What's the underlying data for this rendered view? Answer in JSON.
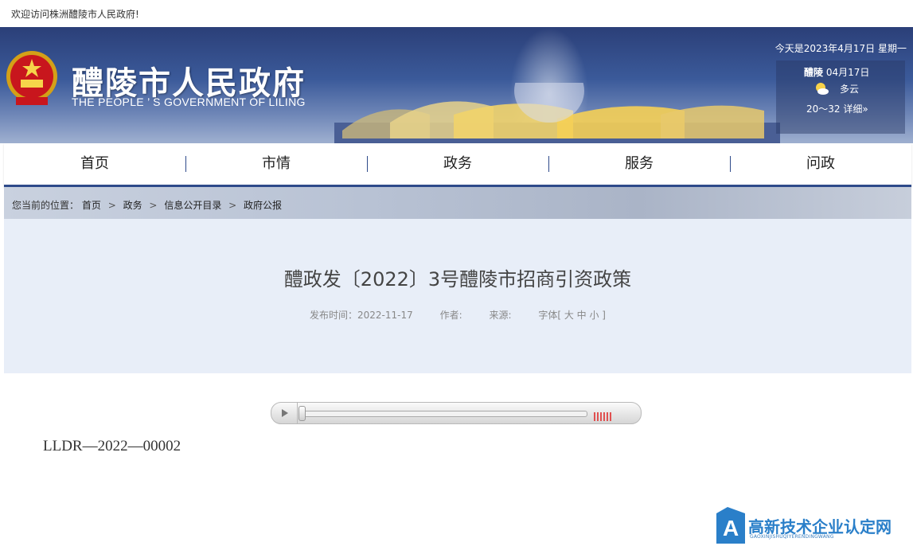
{
  "topbar": {
    "welcome": "欢迎访问株洲醴陵市人民政府!"
  },
  "header": {
    "site_title": "醴陵市人民政府",
    "site_title_en": "THE PEOPLE ’ S GOVERNMENT OF LILING",
    "date": "今天是2023年4月17日 星期一",
    "weather": {
      "city": "醴陵",
      "date": "04月17日",
      "icon": "sun-cloud-icon",
      "condition": "多云",
      "temp": "20～32",
      "detail": "详细»"
    }
  },
  "nav": {
    "items": [
      "首页",
      "市情",
      "政务",
      "服务",
      "问政"
    ]
  },
  "breadcrumb": {
    "label": "您当前的位置：",
    "items": [
      "首页",
      "政务",
      "信息公开目录",
      "政府公报"
    ],
    "separator": ">"
  },
  "article": {
    "title": "醴政发〔2022〕3号醴陵市招商引资政策",
    "publish_label": "发布时间：2022-11-17",
    "author_label": "作者:",
    "source_label": "来源:",
    "font_size_label": "字体[ 大 中 小 ]",
    "doc_number": "LLDR—2022—00002"
  },
  "audio_player": {
    "progress": 0.0
  },
  "watermark": {
    "name": "高新技术企业认定网",
    "pinyin": "GAOXINJISHUQIYERENDINGWANG"
  },
  "colors": {
    "nav_accent": "#2e4a8a",
    "title_panel_bg": "#e8eef8",
    "watermark_blue": "#2a7fc9"
  }
}
